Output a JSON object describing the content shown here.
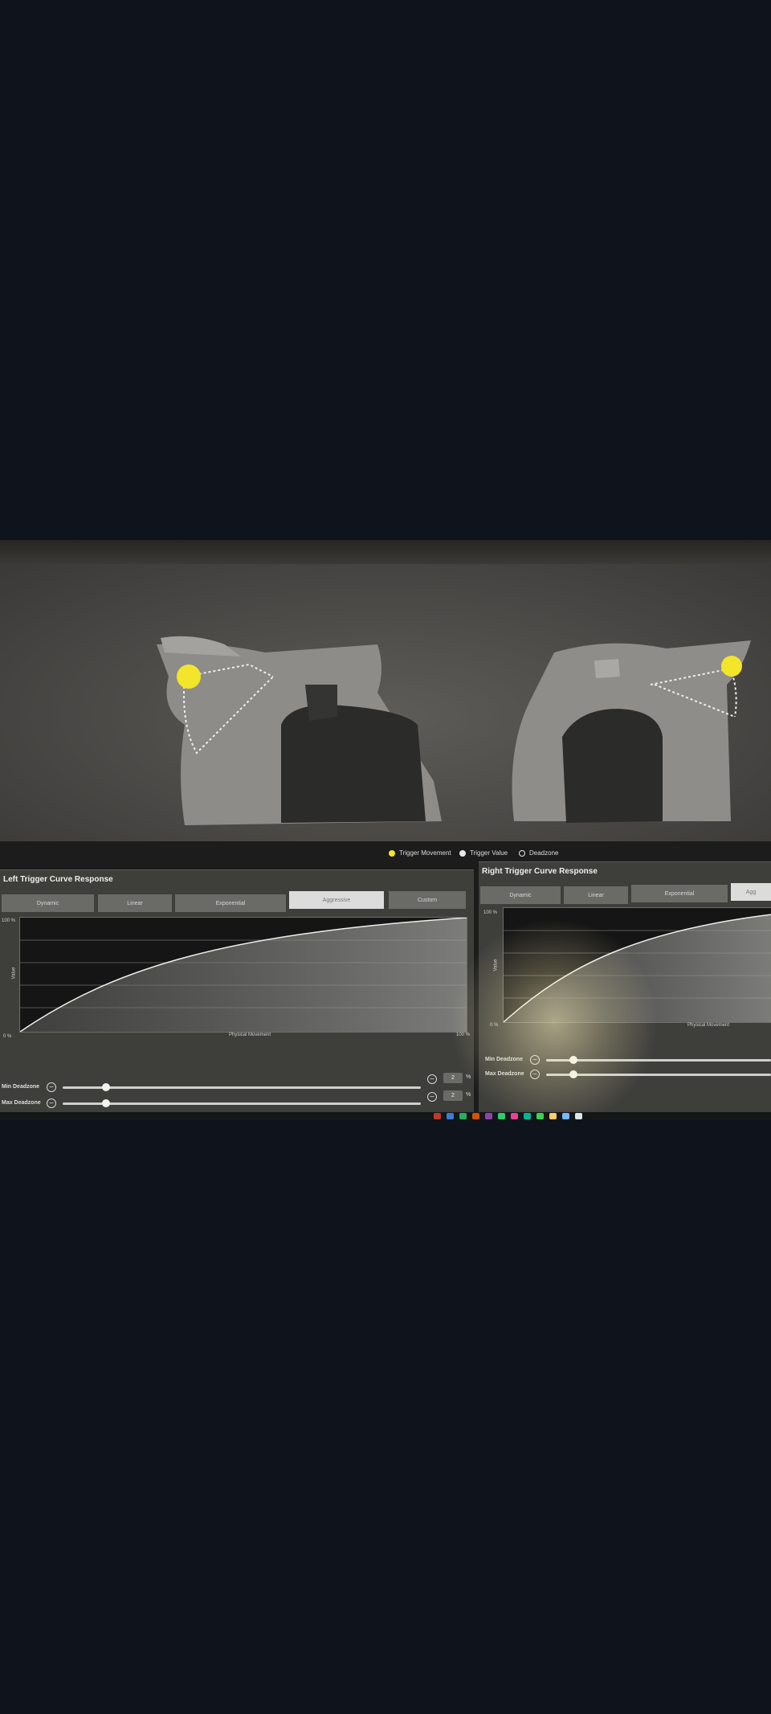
{
  "legend": {
    "trigger_movement": "Trigger Movement",
    "trigger_value": "Trigger Value",
    "deadzone": "Deadzone"
  },
  "colors": {
    "trigger_marker": "#f3e52a",
    "active_button": "#dcdcdc",
    "button": "#6a6a67",
    "panel": "#3e3e3b"
  },
  "left": {
    "title": "Left Trigger Curve Response",
    "buttons": [
      "Dynamic",
      "Linear",
      "Exponential",
      "Aggressive",
      "Custom"
    ],
    "active": "Aggressive",
    "plot": {
      "y_top": "100 %",
      "y_bottom": "0 %",
      "x_right": "100 %",
      "y_label": "Value",
      "x_label": "Physical Movement"
    },
    "min_deadzone": {
      "label": "Min Deadzone",
      "value": "2",
      "unit": "%",
      "level": 0.12
    },
    "max_deadzone": {
      "label": "Max Deadzone",
      "value": "2",
      "unit": "%",
      "level": 0.12
    }
  },
  "right": {
    "title": "Right Trigger Curve Response",
    "buttons": [
      "Dynamic",
      "Linear",
      "Exponential",
      "Agg"
    ],
    "active": "Agg",
    "plot": {
      "y_top": "100 %",
      "y_bottom": "0 %",
      "y_label": "Value",
      "x_label": "Physical Movement"
    },
    "min_deadzone": {
      "label": "Min Deadzone",
      "level": 0.12
    },
    "max_deadzone": {
      "label": "Max Deadzone",
      "level": 0.12
    }
  },
  "icons": {
    "left_trigger_marker": "circle-marker-icon",
    "right_trigger_marker": "circle-marker-icon",
    "deadzone_decrease": "minus-icon"
  }
}
